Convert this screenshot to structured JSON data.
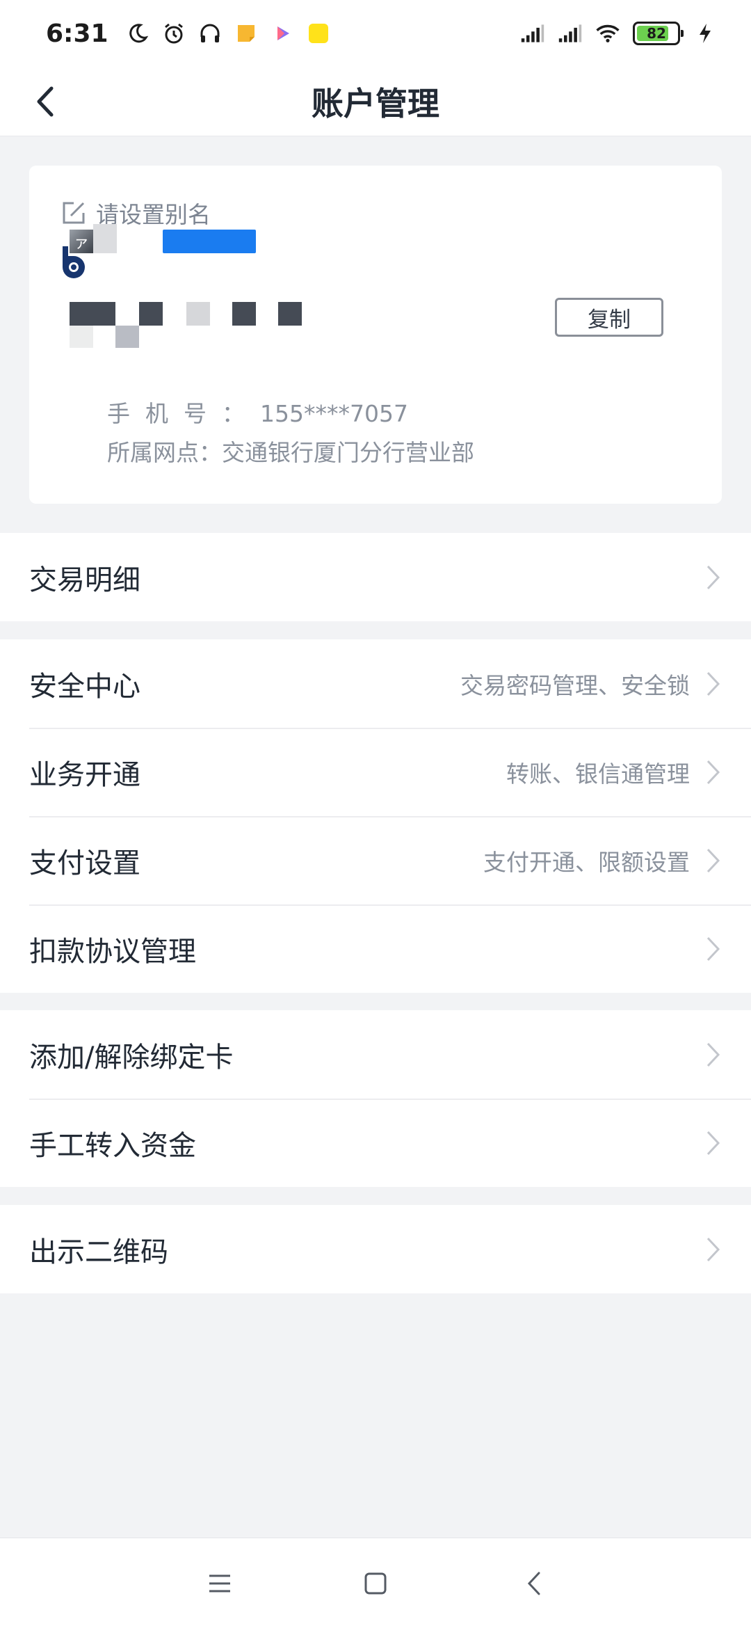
{
  "status_bar": {
    "time": "6:31",
    "battery": "82",
    "battery_level": 0.82,
    "icons": [
      "moon-icon",
      "alarm-icon",
      "headphones-icon",
      "notes-app-icon",
      "video-app-icon",
      "yy-app-icon",
      "signal-icon",
      "signal-icon",
      "wifi-icon",
      "battery-icon",
      "charging-icon"
    ],
    "yy_badge": "YY"
  },
  "nav": {
    "title": "账户管理",
    "back_icon": "chevron-left-icon"
  },
  "account": {
    "alias_placeholder": "请设置别名",
    "edit_icon": "edit-icon",
    "bank_logo": "bank-of-communications-logo",
    "masked_glyph": "ァ",
    "copy_label": "复制",
    "phone_label": "手机号：",
    "phone_value": "155****7057",
    "branch_label": "所属网点：",
    "branch_value": "交通银行厦门分行营业部"
  },
  "menu_groups": [
    {
      "items": [
        {
          "label": "交易明细",
          "hint": ""
        }
      ]
    },
    {
      "items": [
        {
          "label": "安全中心",
          "hint": "交易密码管理、安全锁"
        },
        {
          "label": "业务开通",
          "hint": "转账、银信通管理"
        },
        {
          "label": "支付设置",
          "hint": "支付开通、限额设置"
        },
        {
          "label": "扣款协议管理",
          "hint": ""
        }
      ]
    },
    {
      "items": [
        {
          "label": "添加/解除绑定卡",
          "hint": ""
        },
        {
          "label": "手工转入资金",
          "hint": ""
        }
      ]
    },
    {
      "items": [
        {
          "label": "出示二维码",
          "hint": ""
        }
      ]
    }
  ],
  "system_nav": {
    "menu_icon": "menu-icon",
    "home_icon": "home-square-icon",
    "back_icon": "back-triangle-icon"
  },
  "colors": {
    "accent_blue": "#1a7cf0",
    "background": "#f2f3f5",
    "text_primary": "#222a35",
    "text_secondary": "#8a919c",
    "battery_green": "#6cd04f"
  }
}
